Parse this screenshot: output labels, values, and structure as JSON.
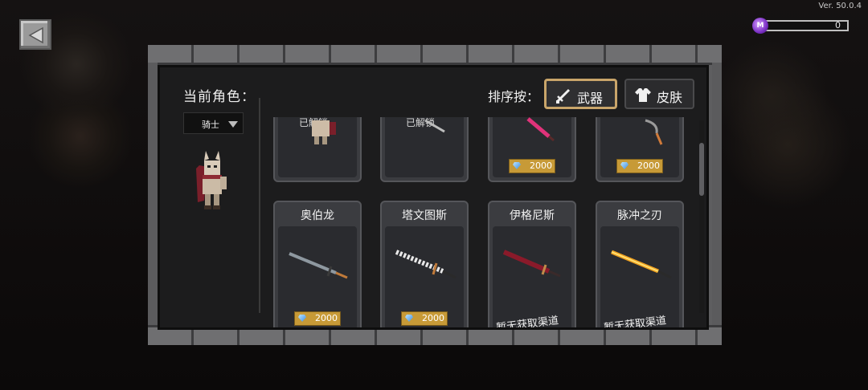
{
  "version": "Ver. 50.0.4",
  "currency": {
    "icon": "purple-gem-coin-icon",
    "icon_letter": "M",
    "value": "0"
  },
  "panel": {
    "role_label": "当前角色：",
    "role_select": "骑士",
    "sort_label": "排序按：",
    "sort_buttons": [
      {
        "label": "武器",
        "icon": "sword-icon",
        "active": true
      },
      {
        "label": "皮肤",
        "icon": "shirt-icon",
        "active": false
      }
    ]
  },
  "cards_top": [
    {
      "label": "已解锁",
      "kind": "skin"
    },
    {
      "label": "已解锁",
      "kind": "weapon"
    },
    {
      "price": "2000"
    },
    {
      "price": "2000"
    }
  ],
  "cards_bottom": [
    {
      "name": "奥伯龙",
      "price": "2000"
    },
    {
      "name": "塔文图斯",
      "price": "2000"
    },
    {
      "name": "伊格尼斯",
      "status": "暂无获取渠道"
    },
    {
      "name": "脉冲之刃",
      "status": "暂无获取渠道"
    }
  ],
  "colors": {
    "active_border": "#c9a56a",
    "price_bg": "#c79a37",
    "currency": "#7a2fc4"
  }
}
